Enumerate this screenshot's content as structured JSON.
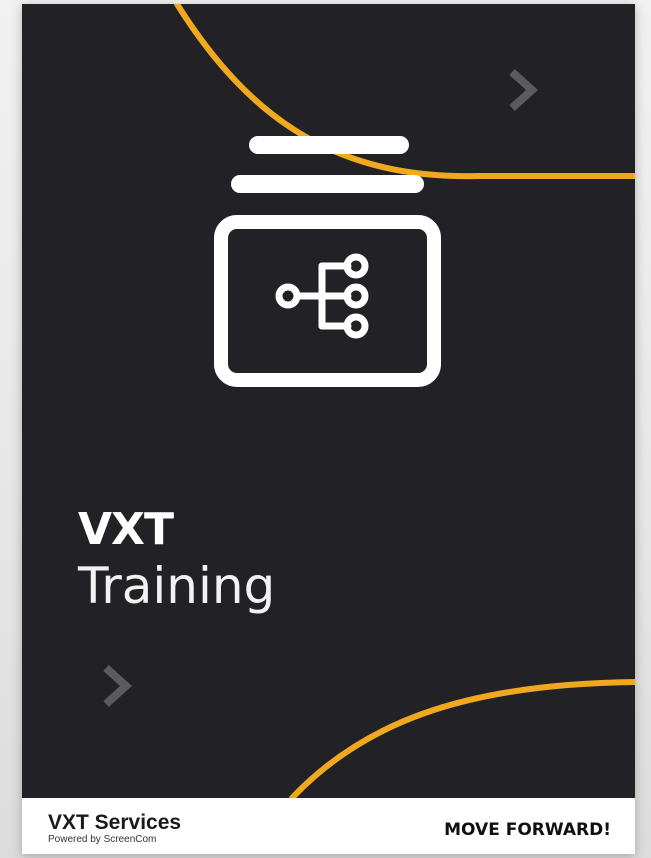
{
  "cover": {
    "title_bold": "VXT",
    "title_light": "Training",
    "icon": "training-module-icon",
    "accent_color": "#F0A81E",
    "background_color": "#222226"
  },
  "footer": {
    "brand_name": "VXT Services",
    "brand_sub": "Powered by ScreenCom",
    "tagline": "MOVE FORWARD!"
  }
}
